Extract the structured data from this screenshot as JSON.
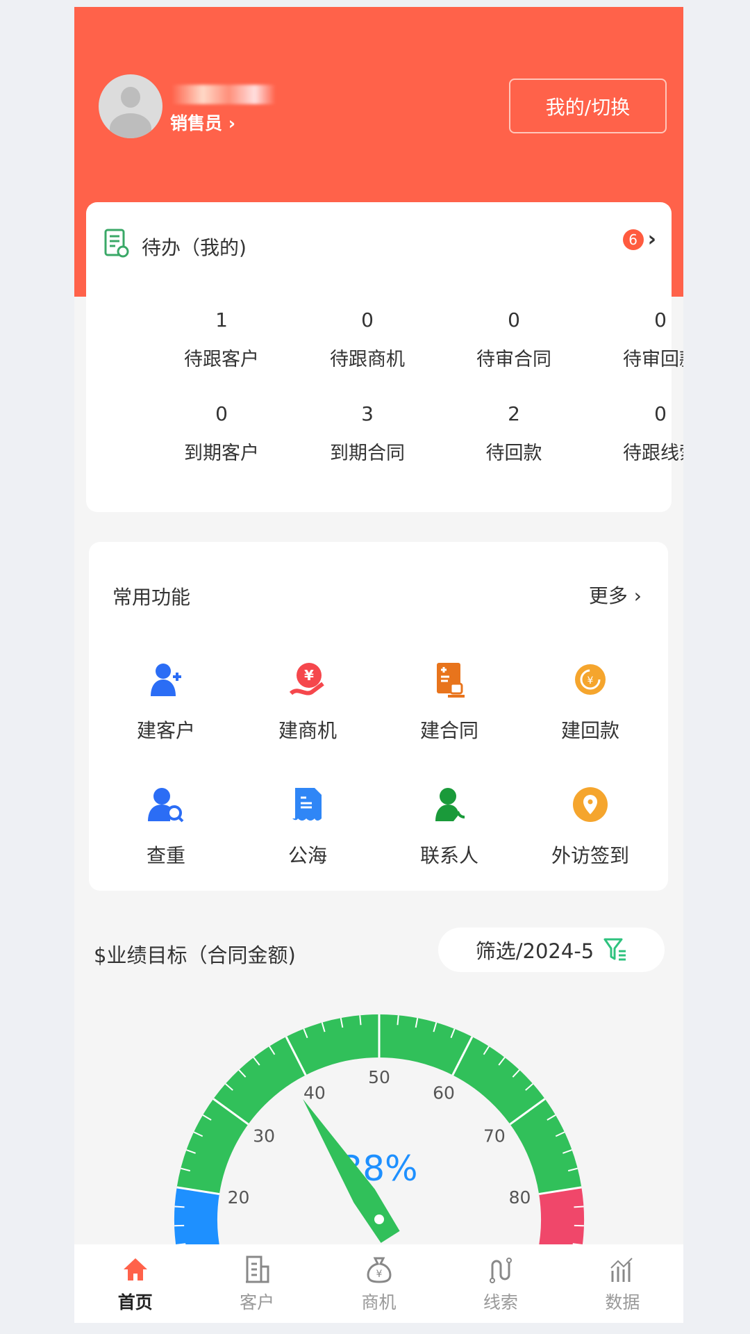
{
  "header": {
    "role": "销售员",
    "role_chevron": "›",
    "switch_button": "我的/切换",
    "bg_color": "#ff624a"
  },
  "todo": {
    "title": "待办（我的)",
    "badge": "6",
    "chevron": "›",
    "items": [
      {
        "value": "1",
        "label": "待跟客户"
      },
      {
        "value": "0",
        "label": "待跟商机"
      },
      {
        "value": "0",
        "label": "待审合同"
      },
      {
        "value": "0",
        "label": "待审回款"
      },
      {
        "value": "0",
        "label": "到期客户"
      },
      {
        "value": "3",
        "label": "到期合同"
      },
      {
        "value": "2",
        "label": "待回款"
      },
      {
        "value": "0",
        "label": "待跟线索"
      }
    ]
  },
  "functions": {
    "title": "常用功能",
    "more": "更多 ›",
    "items": [
      {
        "label": "建客户",
        "icon": "user-add-icon",
        "color": "#2b6df5"
      },
      {
        "label": "建商机",
        "icon": "yuan-hand-icon",
        "color": "#f5474c"
      },
      {
        "label": "建合同",
        "icon": "contract-stamp-icon",
        "color": "#e8741c"
      },
      {
        "label": "建回款",
        "icon": "yuan-return-icon",
        "color": "#f5a52d"
      },
      {
        "label": "查重",
        "icon": "user-search-icon",
        "color": "#2b6df5"
      },
      {
        "label": "公海",
        "icon": "document-wave-icon",
        "color": "#2f86f6"
      },
      {
        "label": "联系人",
        "icon": "contact-phone-icon",
        "color": "#1a9a3a"
      },
      {
        "label": "外访签到",
        "icon": "location-pin-icon",
        "color": "#f5a52d"
      }
    ]
  },
  "performance": {
    "title": "$业绩目标（合同金额)",
    "filter_label": "筛选/2024-5",
    "filter_icon": "filter-icon"
  },
  "chart_data": {
    "type": "gauge",
    "min": 0,
    "max": 100,
    "value": 38,
    "detail": "38%",
    "tick_labels": [
      "20",
      "30",
      "40",
      "50",
      "60",
      "70",
      "80"
    ],
    "bands": [
      {
        "to": 20,
        "color": "#1e90ff"
      },
      {
        "to": 80,
        "color": "#31c05a"
      },
      {
        "to": 100,
        "color": "#f0476a"
      }
    ],
    "needle_color": "#31c05a",
    "detail_color": "#1e90ff"
  },
  "nav": {
    "items": [
      {
        "label": "首页",
        "icon": "home-icon",
        "active": true
      },
      {
        "label": "客户",
        "icon": "building-icon"
      },
      {
        "label": "商机",
        "icon": "money-bag-icon"
      },
      {
        "label": "线索",
        "icon": "route-icon"
      },
      {
        "label": "数据",
        "icon": "chart-icon"
      }
    ],
    "active_color": "#ff624a"
  }
}
